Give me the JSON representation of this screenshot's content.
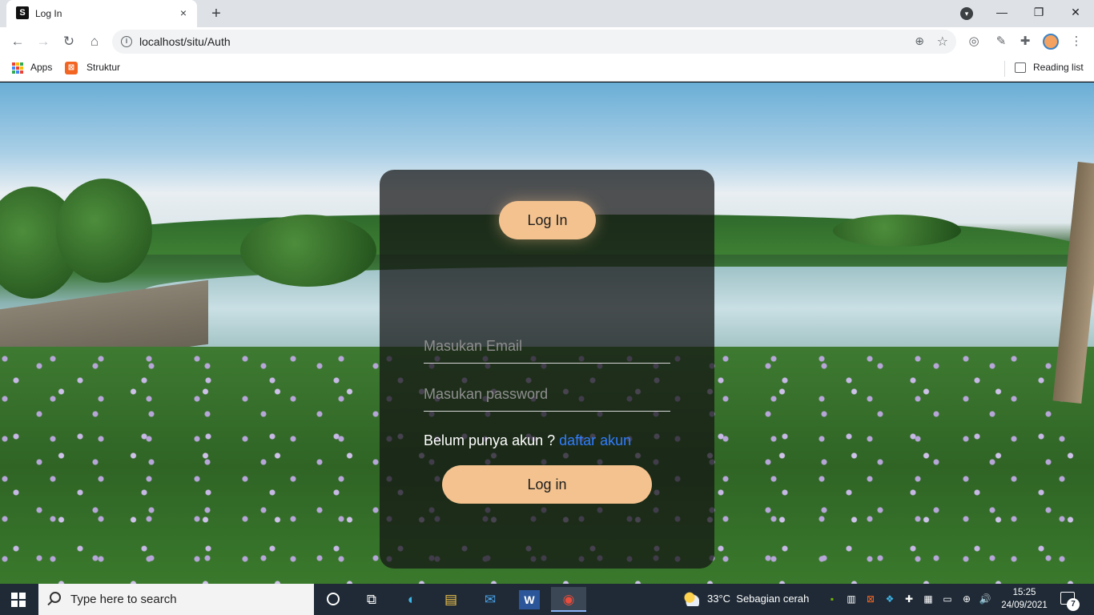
{
  "browser": {
    "tab": {
      "title": "Log In",
      "close_icon": "×",
      "favicon": "S"
    },
    "new_tab_icon": "+",
    "window": {
      "minimize": "—",
      "restore": "❐",
      "close": "✕"
    },
    "toolbar": {
      "back_icon": "←",
      "forward_icon": "→",
      "reload_icon": "↻",
      "home_icon": "⌂",
      "url": "localhost/situ/Auth",
      "zoom_icon": "⊕",
      "bookmark_icon": "☆",
      "extension_icon_1": "◎",
      "extension_icon_2": "✎",
      "puzzle_icon": "✚",
      "menu_icon": "⋮"
    },
    "bookmarks": {
      "apps_label": "Apps",
      "apps_colors": [
        "#ea4335",
        "#fbbc05",
        "#34a853",
        "#4285f4",
        "#ea4335",
        "#fbbc05",
        "#34a853",
        "#4285f4",
        "#ea4335"
      ],
      "struktur_label": "Struktur",
      "struktur_icon": "⊠",
      "reading_list_label": "Reading list"
    }
  },
  "login": {
    "header_button": "Log In",
    "email_placeholder": "Masukan Email",
    "password_placeholder": "Masukan password",
    "register_prompt": "Belum punya akun ?",
    "register_link": "daftar akun",
    "submit_button": "Log in",
    "accent_color": "#f3c28f",
    "link_color": "#2f7dff"
  },
  "taskbar": {
    "search_placeholder": "Type here to search",
    "apps": [
      {
        "name": "task-view",
        "glyph": "⧉"
      },
      {
        "name": "edge",
        "glyph": "◐"
      },
      {
        "name": "file-explorer",
        "glyph": "▤"
      },
      {
        "name": "mail",
        "glyph": "✉"
      },
      {
        "name": "word",
        "glyph": "W"
      },
      {
        "name": "chrome",
        "glyph": "◉"
      }
    ],
    "weather": {
      "temp": "33°C",
      "condition": "Sebagian cerah"
    },
    "tray_icons": [
      "▪",
      "▥",
      "⊠",
      "❖",
      "✚",
      "▦",
      "▭",
      "⊕",
      "🔊"
    ],
    "time": "15:25",
    "date": "24/09/2021",
    "notification_count": "7"
  }
}
